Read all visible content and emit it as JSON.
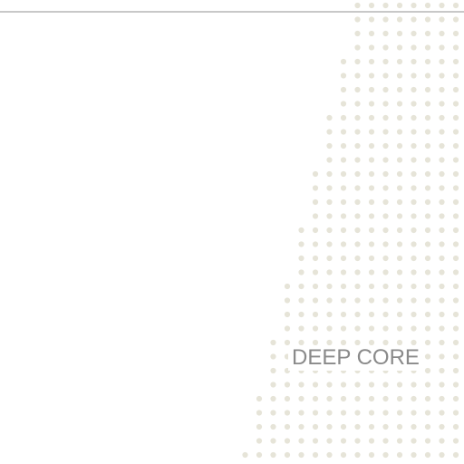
{
  "colors": {
    "background": "#ffffff",
    "rule": "#c8c8c8",
    "dots": "#e6e4d8",
    "label": "#8a8a8a"
  },
  "label": "DEEP CORE"
}
